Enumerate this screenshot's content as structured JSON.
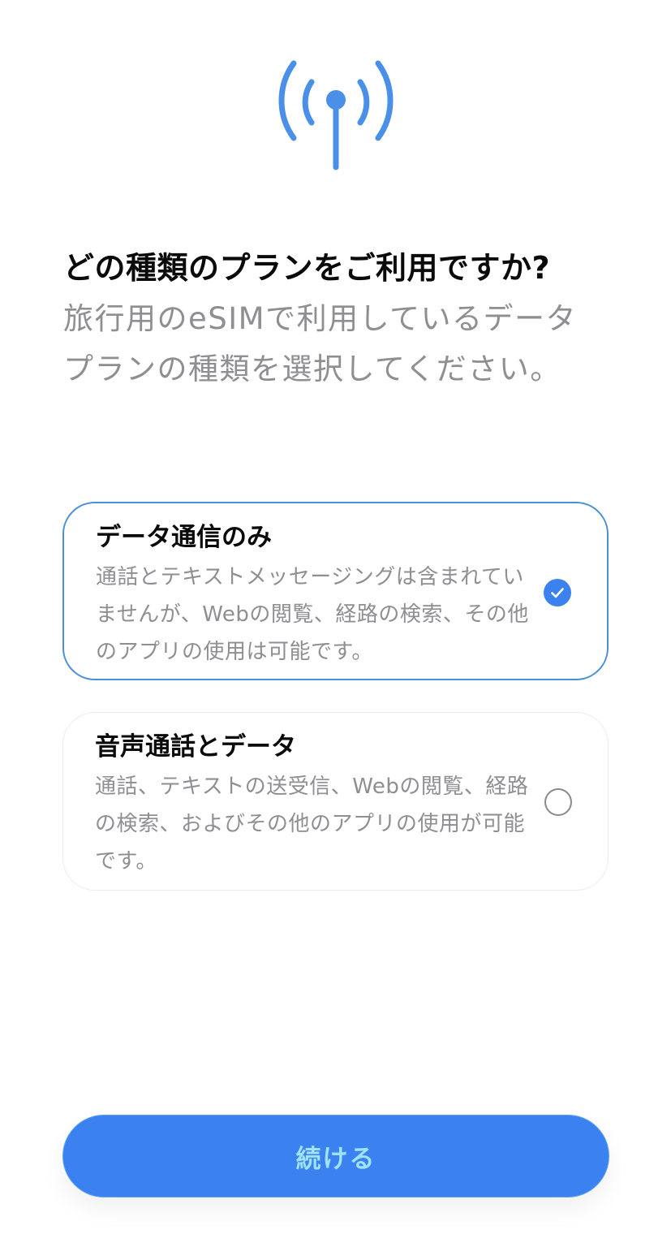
{
  "header": {
    "icon": "antenna-signal-icon",
    "title": "どの種類のプランをご利用ですか?",
    "subtitle": "旅行用のeSIMで利用しているデータプランの種類を選択してください。"
  },
  "options": [
    {
      "title": "データ通信のみ",
      "description": "通話とテキストメッセージングは含まれていませんが、Webの閲覧、経路の検索、その他のアプリの使用は可能です。",
      "selected": true
    },
    {
      "title": "音声通話とデータ",
      "description": "通話、テキストの送受信、Webの閲覧、経路の検索、およびその他のアプリの使用が可能です。",
      "selected": false
    }
  ],
  "footer": {
    "continue_label": "続ける"
  },
  "colors": {
    "accent": "#3b82f0",
    "icon_blue": "#4a90e8",
    "selected_border": "#4a90d9",
    "secondary_text": "#8e8e93",
    "button_text": "#9fe3ff"
  }
}
